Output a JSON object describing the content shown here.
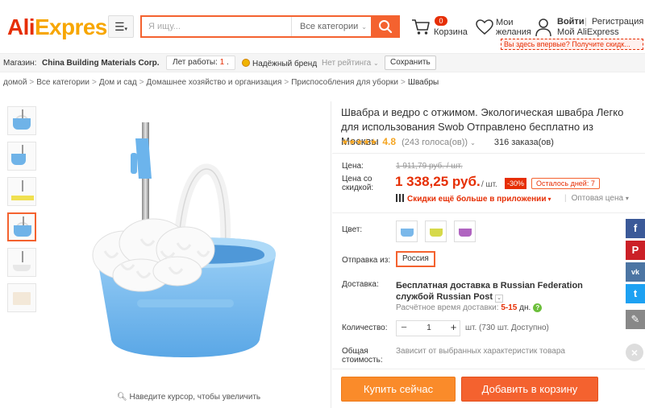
{
  "header": {
    "logo_ali": "Ali",
    "logo_express": "Express",
    "logo_tm": "®",
    "menu_icon": "hamburger-menu-icon",
    "search_placeholder": "Я ищу...",
    "search_category": "Все категории",
    "cart_count": "0",
    "cart_label": "Корзина",
    "wish_label": "Мои желания",
    "login": "Войти",
    "sep": "|",
    "register": "Регистрация",
    "my_account": "Мой AliExpress",
    "promo": "Вы здесь впервые? Получите скидк..."
  },
  "store": {
    "label": "Магазин:",
    "name": "China Building Materials Corp.",
    "years_prefix": "Лет работы:",
    "years": "1",
    "years_suffix": ".",
    "brand": "Надёжный бренд",
    "rating": "Нет рейтинга",
    "save": "Сохранить"
  },
  "breadcrumb": [
    "домой",
    "Все категории",
    "Дом и сад",
    "Домашнее хозяйство и организация",
    "Приспособления для уборки",
    "Швабры"
  ],
  "gallery": {
    "zoom_hint": "Наведите курсор, чтобы увеличить"
  },
  "product": {
    "title": "Швабра и ведро с отжимом. Экологическая швабра Легко для использования Swob Отправлено бесплатно из Москвы",
    "stars": "★★★★★",
    "rating": "4.8",
    "votes": "(243 голоса(ов))",
    "orders": "316 заказа(ов)",
    "price_label": "Цена:",
    "price_old": "1 911,79 руб. / шт.",
    "discount_label": "Цена со скидкой:",
    "price_new": "1 338,25 руб.",
    "price_unit": "/ шт.",
    "discount_pct": "-30%",
    "days_left": "Осталось дней: 7",
    "app_offer": "Скидки ещё больше в приложении",
    "wholesale": "Оптовая цена",
    "color_label": "Цвет:",
    "ship_from_label": "Отправка из:",
    "ship_from": "Россия",
    "delivery_label": "Доставка:",
    "delivery_main": "Бесплатная доставка в Russian Federation службой Russian Post",
    "delivery_time_label": "Расчётное время доставки:",
    "delivery_days": "5-15",
    "delivery_unit": "дн.",
    "qty_label": "Количество:",
    "qty_value": "1",
    "qty_info": "шт. (730 шт. Доступно)",
    "total_label": "Общая стоимость:",
    "total_value": "Зависит от выбранных характеристик товара",
    "buy_now": "Купить сейчас",
    "add_to_cart": "Добавить в корзину"
  },
  "social": {
    "fb": "f",
    "pin": "P",
    "vk": "vk",
    "tw": "t",
    "edit": "✎",
    "close": "×"
  },
  "colors": {
    "accent": "#f4622f",
    "price": "#e62e04",
    "buy": "#fa8b2a",
    "star": "#f5a623"
  }
}
